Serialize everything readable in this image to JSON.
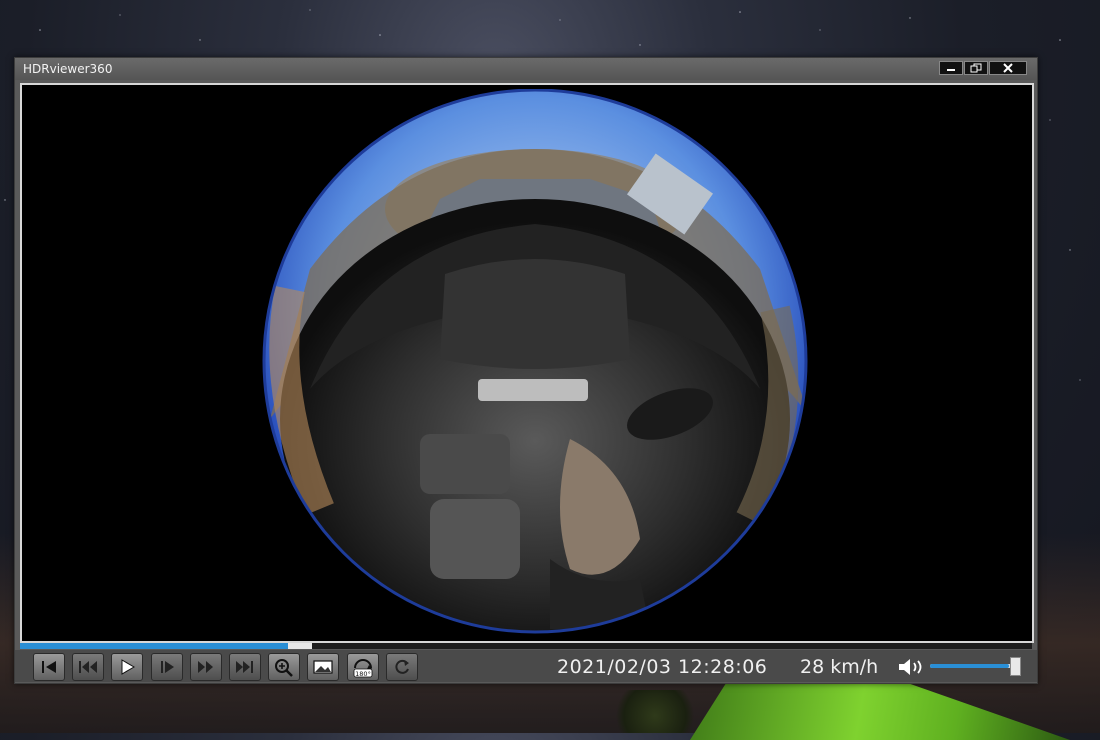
{
  "window": {
    "title": "HDRviewer360"
  },
  "title_buttons": {
    "minimize": "minimize",
    "restore": "restore",
    "close": "close"
  },
  "status": {
    "datetime": "2021/02/03 12:28:06",
    "speed": "28 km/h"
  },
  "playback": {
    "progress_fraction": 0.265,
    "buffered_fraction": 0.024,
    "volume_fraction": 0.93
  },
  "controls": [
    {
      "name": "skip-to-start-button",
      "icon": "skip-start-icon"
    },
    {
      "name": "rewind-button",
      "icon": "rewind-icon"
    },
    {
      "name": "play-button",
      "icon": "play-icon"
    },
    {
      "name": "step-forward-button",
      "icon": "step-forward-icon"
    },
    {
      "name": "fast-forward-button",
      "icon": "fast-forward-icon"
    },
    {
      "name": "skip-to-end-button",
      "icon": "skip-end-icon"
    },
    {
      "name": "zoom-button",
      "icon": "zoom-in-icon"
    },
    {
      "name": "view-mode-button",
      "icon": "panorama-icon"
    },
    {
      "name": "rotate-180-button",
      "icon": "rotate-180-icon"
    },
    {
      "name": "refresh-button",
      "icon": "refresh-icon"
    }
  ],
  "colors": {
    "accent": "#2a8fd6",
    "window": "#5a5a5a",
    "video_bg": "#000000"
  }
}
